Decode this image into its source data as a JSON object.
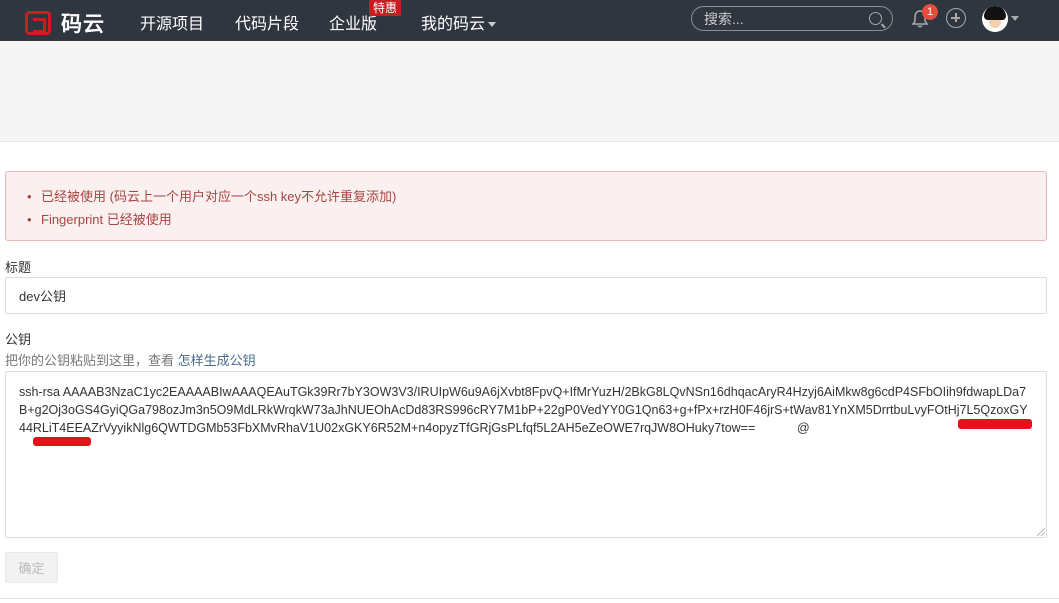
{
  "header": {
    "logo_text": "码云",
    "nav": [
      {
        "label": "开源项目"
      },
      {
        "label": "代码片段"
      },
      {
        "label": "企业版"
      },
      {
        "label": "我的码云"
      }
    ],
    "enterprise_badge": "特惠",
    "search_placeholder": "搜索...",
    "notification_count": "1"
  },
  "alert": {
    "errors": [
      "已经被使用 (码云上一个用户对应一个ssh key不允许重复添加)",
      "Fingerprint 已经被使用"
    ]
  },
  "form": {
    "title_label": "标题",
    "title_value": "dev公钥",
    "key_label": "公钥",
    "key_hint_prefix": "把你的公钥粘贴到这里，查看",
    "key_hint_link": "怎样生成公钥",
    "key_value": "ssh-rsa AAAAB3NzaC1yc2EAAAABIwAAAQEAuTGk39Rr7bY3OW3V3/IRUIpW6u9A6jXvbt8FpvQ+IfMrYuzH/2BkG8LQvNSn16dhqacAryR4Hzyj6AiMkw8g6cdP4SFbOIih9fdwapLDa7B+g2Oj3oGS4GyiQGa798ozJm3n5O9MdLRkWrqkW73aJhNUEOhAcDd83RS996cRY7M1bP+22gP0VedYY0G1Qn63+g+fPx+rzH0F46jrS+tWav81YnXM5DrrtbuLvyFOtHj7L5QzoxGY44RLiT4EEAZrVyyikNlg6QWTDGMb53FbXMvRhaV1U02xGKY6R52M+n4opyzTfGRjGsPLfqf5L2AH5eZeOWE7rqJW8OHuky7tow==            @",
    "submit_label": "确定"
  },
  "colors": {
    "header_bg": "#2f3640",
    "brand_red": "#c71d23",
    "error_text": "#a94442",
    "error_bg": "#fbf0f0"
  }
}
